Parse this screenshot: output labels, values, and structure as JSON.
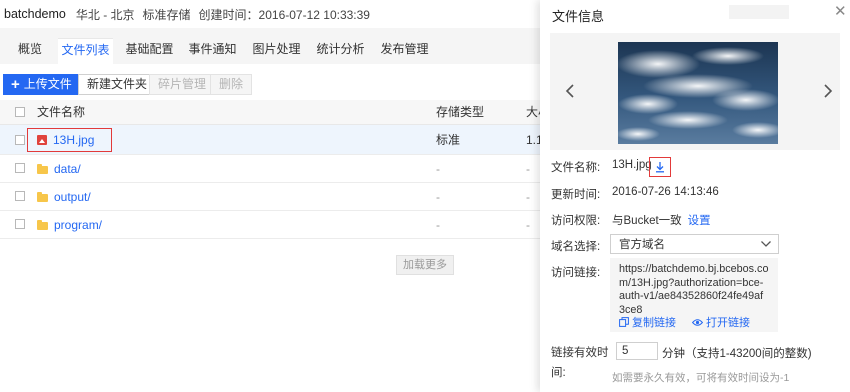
{
  "bucket": {
    "name": "batchdemo",
    "region": "华北 - 北京",
    "storage_class": "标准存储",
    "created": "创建时间：2016-07-12 10:33:39"
  },
  "tabs": [
    {
      "label": "概览",
      "active": false
    },
    {
      "label": "文件列表",
      "active": true
    },
    {
      "label": "基础配置",
      "active": false
    },
    {
      "label": "事件通知",
      "active": false
    },
    {
      "label": "图片处理",
      "active": false
    },
    {
      "label": "统计分析",
      "active": false
    },
    {
      "label": "发布管理",
      "active": false
    }
  ],
  "toolbar": {
    "upload_label": "上传文件",
    "new_folder_label": "新建文件夹",
    "fragments_label": "碎片管理",
    "delete_label": "删除"
  },
  "table": {
    "headers": {
      "name": "文件名称",
      "type": "存储类型",
      "size": "大小"
    },
    "rows": [
      {
        "name": "13H.jpg",
        "kind": "image",
        "type": "标准",
        "size": "1.1",
        "selected": true
      },
      {
        "name": "data/",
        "kind": "folder",
        "type": "-",
        "size": "-",
        "selected": false
      },
      {
        "name": "output/",
        "kind": "folder",
        "type": "-",
        "size": "-",
        "selected": false
      },
      {
        "name": "program/",
        "kind": "folder",
        "type": "-",
        "size": "-",
        "selected": false
      }
    ],
    "load_more_label": "加载更多"
  },
  "drawer": {
    "title": "文件信息",
    "fields": {
      "file_name_label": "文件名称:",
      "file_name": "13H.jpg",
      "updated_label": "更新时间:",
      "updated": "2016-07-26 14:13:46",
      "permission_label": "访问权限:",
      "permission": "与Bucket一致",
      "permission_link": "设置",
      "domain_label": "域名选择:",
      "domain_selected": "官方域名",
      "link_label": "访问链接:",
      "link_url": "https://batchdemo.bj.bcebos.com/13H.jpg?authorization=bce-auth-v1/ae84352860f24fe49af3ce8",
      "copy_link_label": "复制链接",
      "open_link_label": "打开链接",
      "expiry_label_line1": "链接有效时",
      "expiry_label_line2": "间:",
      "expiry_value": "5",
      "expiry_unit": "分钟（支持1-43200间的整数)",
      "expiry_hint": "如需要永久有效，可将有效时间设为-1"
    }
  },
  "colors": {
    "accent": "#2468f2",
    "highlight": "#e23a3a",
    "folder": "#f7c64a"
  }
}
